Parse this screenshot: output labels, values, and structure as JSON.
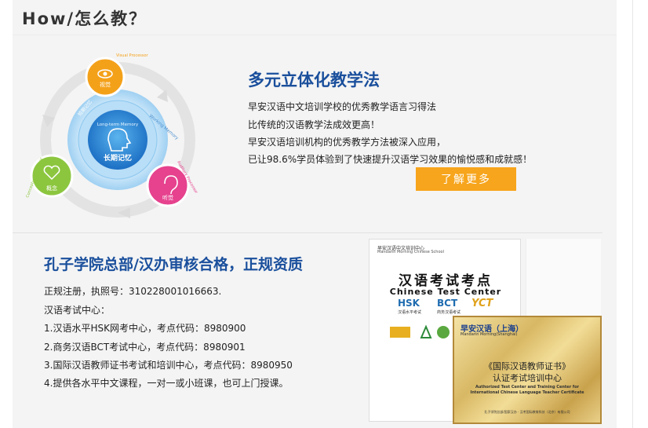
{
  "heading": "How/怎么教？",
  "section1": {
    "title": "多元立体化教学法",
    "lines": [
      "早安汉语中文培训学校的优秀教学语言习得法",
      "比传统的汉语教学法成效更高！",
      "早安汉语培训机构的优秀教学方法被深入应用，",
      "已让98.6%学员体验到了快速提升汉语学习效果的愉悦感和成就感！"
    ],
    "button_label": "了解更多"
  },
  "diagram": {
    "center_cn": "长期记忆",
    "center_en": "Long-term Memory",
    "working_memory": "Working Memory",
    "short_term": "短期记忆",
    "nodes": [
      {
        "label": "视觉",
        "en": "Visual Processor",
        "color": "#f4a11a"
      },
      {
        "label": "概念",
        "en": "Conceptual Processor",
        "color": "#8cc63f"
      },
      {
        "label": "听觉",
        "en": "Auditory Processor",
        "color": "#e6428e"
      }
    ]
  },
  "section2": {
    "title": "孔子学院总部/汉办审核合格，正规资质",
    "lines": [
      "正规注册，执照号：310228001016663.",
      "汉语考试中心：",
      "1.汉语水平HSK网考中心，考点代码：8980900",
      "2.商务汉语BCT考试中心，考点代码：8980901",
      "3.国际汉语教师证书考试和培训中心，考点代码：8980950",
      "4.提供各水平中文课程，一对一或小班课，也可上门授课。"
    ]
  },
  "cert1": {
    "school_cn": "早安汉语中文培训中心",
    "school_en": "Mandarin Morning Chinese School",
    "title_cn": "汉语考试考点",
    "title_en": "Chinese Test Center",
    "logo_hsk": "HSK",
    "logo_hsk_sub": "汉语水平考试",
    "logo_bct": "BCT",
    "logo_bct_sub": "商务汉语考试",
    "logo_yct": "YCT"
  },
  "cert2": {
    "school_cn": "早安汉语（上海）",
    "school_en": "Mandarin Morning(Shanghai)",
    "line1": "《国际汉语教师证书》",
    "line2": "认证考试培训中心",
    "line3": "Authorized Test Center and Training Center for",
    "line4": "International Chinese Language Teacher Certificate",
    "footer": "孔子学院总部/国家汉办 · 汉考国际教育科技（北京）有限公司"
  }
}
